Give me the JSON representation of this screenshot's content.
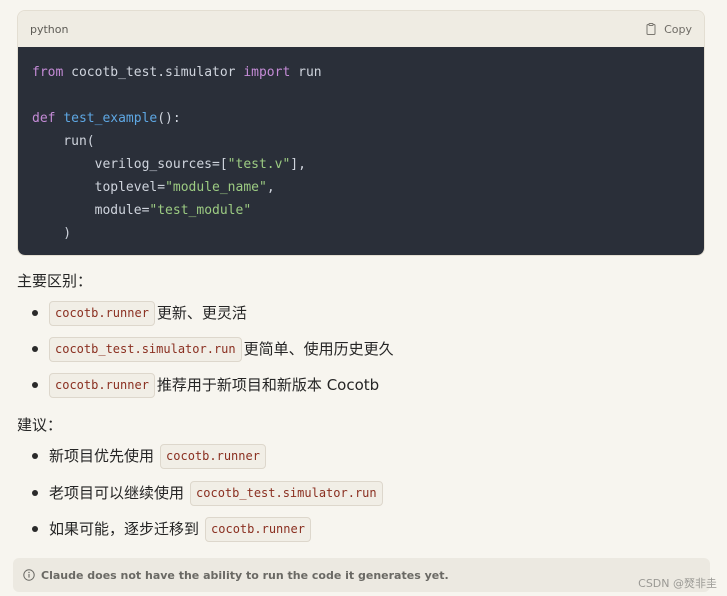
{
  "code_block": {
    "language": "python",
    "copy_label": "Copy",
    "lines": [
      [
        {
          "t": "from",
          "c": "kw"
        },
        {
          "t": " cocotb_test.simulator ",
          "c": "plain"
        },
        {
          "t": "import",
          "c": "kw"
        },
        {
          "t": " run",
          "c": "plain"
        }
      ],
      [
        {
          "t": "",
          "c": "plain"
        }
      ],
      [
        {
          "t": "def",
          "c": "kw"
        },
        {
          "t": " ",
          "c": "plain"
        },
        {
          "t": "test_example",
          "c": "fn"
        },
        {
          "t": "():",
          "c": "plain"
        }
      ],
      [
        {
          "t": "    run(",
          "c": "plain"
        }
      ],
      [
        {
          "t": "        verilog_sources=[",
          "c": "plain"
        },
        {
          "t": "\"test.v\"",
          "c": "str"
        },
        {
          "t": "],",
          "c": "plain"
        }
      ],
      [
        {
          "t": "        toplevel=",
          "c": "plain"
        },
        {
          "t": "\"module_name\"",
          "c": "str"
        },
        {
          "t": ",",
          "c": "plain"
        }
      ],
      [
        {
          "t": "        module=",
          "c": "plain"
        },
        {
          "t": "\"test_module\"",
          "c": "str"
        }
      ],
      [
        {
          "t": "    )",
          "c": "plain"
        }
      ]
    ]
  },
  "section1": {
    "title": "主要区别：",
    "items": [
      {
        "code": "cocotb.runner",
        "text": "更新、更灵活"
      },
      {
        "code": "cocotb_test.simulator.run",
        "text": "更简单、使用历史更久"
      },
      {
        "code": "cocotb.runner",
        "text": "推荐用于新项目和新版本 Cocotb"
      }
    ]
  },
  "section2": {
    "title": "建议：",
    "items": [
      {
        "text": "新项目优先使用",
        "code": "cocotb.runner"
      },
      {
        "text": "老项目可以继续使用",
        "code": "cocotb_test.simulator.run"
      },
      {
        "text": "如果可能，逐步迁移到",
        "code": "cocotb.runner"
      }
    ]
  },
  "notice": {
    "text": "Claude does not have the ability to run the code it generates yet."
  },
  "watermark": "CSDN @燹非圭"
}
